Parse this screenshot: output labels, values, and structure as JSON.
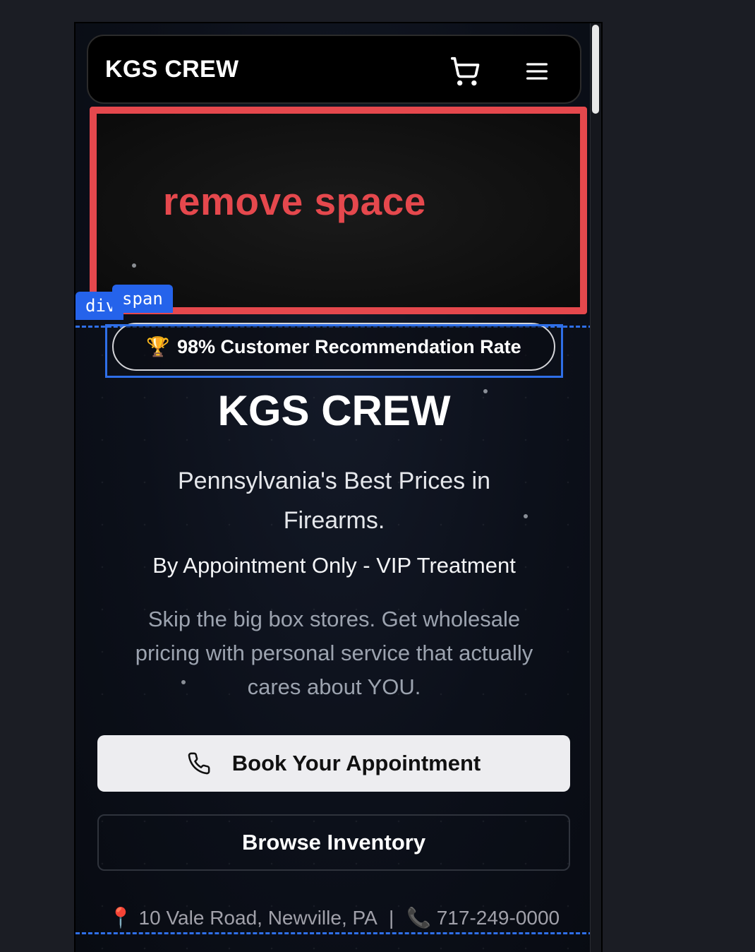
{
  "navbar": {
    "brand": "KGS CREW",
    "cart_icon": "cart-icon",
    "menu_icon": "hamburger-menu-icon"
  },
  "annotation": {
    "text": "remove space",
    "color": "#e5484d"
  },
  "devtools": {
    "tag_div": "div",
    "tag_span": "span",
    "highlight_color": "#2f6fe8"
  },
  "hero": {
    "badge_icon": "🏆",
    "badge_text": "98% Customer Recommendation Rate",
    "title": "KGS CREW",
    "subtitle": "Pennsylvania's Best Prices in Firearms.",
    "tagline": "By Appointment Only - VIP Treatment",
    "description": "Skip the big box stores. Get wholesale pricing with personal service that actually cares about YOU.",
    "primary_button": {
      "label": "Book Your Appointment",
      "icon": "phone-icon"
    },
    "secondary_button": {
      "label": "Browse Inventory"
    },
    "contact": {
      "location_icon": "📍",
      "address": "10 Vale Road, Newville, PA",
      "separator": "|",
      "phone_icon": "📞",
      "phone": "717-249-0000"
    }
  }
}
